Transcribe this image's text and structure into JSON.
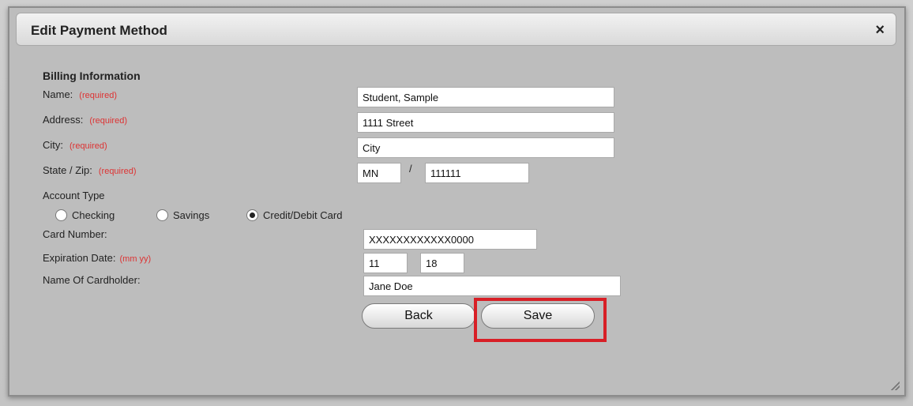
{
  "dialog": {
    "title": "Edit Payment Method",
    "close_glyph": "×"
  },
  "billing": {
    "heading": "Billing Information",
    "name_label": "Name:",
    "address_label": "Address:",
    "city_label": "City:",
    "statezip_label": "State / Zip:",
    "required_text": "(required)",
    "name_value": "Student, Sample",
    "address_value": "1111 Street",
    "city_value": "City",
    "state_value": "MN",
    "zip_value": "111111",
    "slash": "/"
  },
  "account": {
    "label": "Account Type",
    "options": [
      "Checking",
      "Savings",
      "Credit/Debit Card"
    ],
    "selected": "Credit/Debit Card"
  },
  "card": {
    "number_label": "Card Number:",
    "number_value": "XXXXXXXXXXXX0000",
    "expiration_label": "Expiration Date:",
    "expiration_hint": "(mm yy)",
    "exp_month": "11",
    "exp_year": "18",
    "holder_label": "Name Of Cardholder:",
    "holder_value": "Jane Doe"
  },
  "buttons": {
    "back": "Back",
    "save": "Save"
  },
  "colors": {
    "required": "#dd3333",
    "highlight": "#d81f26"
  }
}
